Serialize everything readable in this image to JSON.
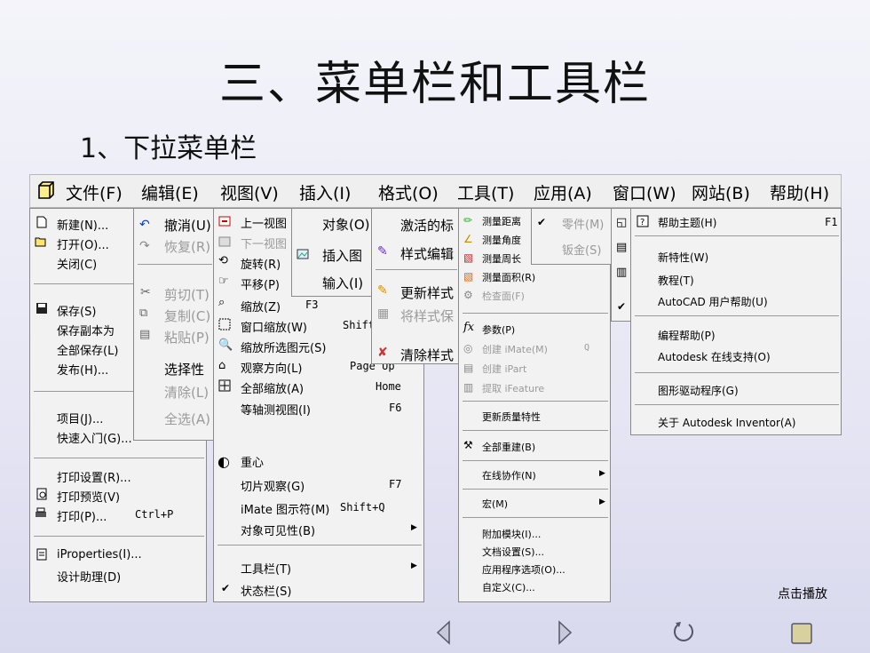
{
  "title": "三、菜单栏和工具栏",
  "subtitle": "1、下拉菜单栏",
  "menubar": [
    "文件(F)",
    "编辑(E)",
    "视图(V)",
    "插入(I)",
    "格式(O)",
    "工具(T)",
    "应用(A)",
    "窗口(W)",
    "网站(B)",
    "帮助(H)"
  ],
  "file_menu": {
    "items": [
      "新建(N)...",
      "打开(O)...",
      "关闭(C)",
      "保存(S)",
      "保存副本为",
      "全部保存(L)",
      "发布(H)...",
      "项目(J)...",
      "快速入门(G)",
      "打印设置(R)...",
      "打印预览(V)",
      "打印(P)...",
      "iProperties(I)...",
      "设计助理(D)"
    ],
    "print_shortcut": "Ctrl+P",
    "quick_suffix": "..."
  },
  "edit_menu": {
    "items": [
      "撤消(U)",
      "恢复(R)",
      "剪切(T)",
      "复制(C)",
      "粘贴(P)",
      "选择性",
      "清除(L)",
      "全选(A)"
    ]
  },
  "view_menu": {
    "items": [
      "上一视图",
      "下一视图",
      "旋转(R)",
      "平移(P)",
      "缩放(Z)",
      "窗口缩放(W)",
      "缩放所选图元(S)",
      "观察方向(L)",
      "全部缩放(A)",
      "等轴测视图(I)",
      "重心",
      "切片观察(G)",
      "iMate 图示符(M)",
      "对象可见性(B)",
      "工具栏(T)",
      "状态栏(S)"
    ],
    "shortcuts": [
      "F3",
      "Shift",
      "Page Up",
      "Home",
      "F6",
      "F7",
      "Shift+Q"
    ]
  },
  "insert_menu": {
    "items": [
      "对象(O)",
      "插入图",
      "输入(I)"
    ]
  },
  "format_menu": {
    "items": [
      "激活的标",
      "样式编辑",
      "更新样式",
      "将样式保",
      "清除样式"
    ]
  },
  "tools_menu": {
    "items": [
      "测量距离",
      "测量角度",
      "测量周长",
      "测量面积(R)",
      "检查面(F)",
      "参数(P)",
      "创建 iMate(M)",
      "创建 iPart",
      "提取 iFeature",
      "更新质量特性",
      "全部重建(B)",
      "在线协作(N)",
      "宏(M)",
      "附加模块(I)...",
      "文档设置(S)...",
      "应用程序选项(O)...",
      "自定义(C)..."
    ],
    "imate_shortcut": "Q"
  },
  "apps_menu": {
    "items": [
      "零件(M)",
      "钣金(S)"
    ]
  },
  "help_menu": {
    "items": [
      "帮助主题(H)",
      "新特性(W)",
      "教程(T)",
      "AutoCAD 用户帮助(U)",
      "编程帮助(P)",
      "Autodesk 在线支持(O)",
      "图形驱动程序(G)",
      "关于 Autodesk Inventor(A)"
    ],
    "f1": "F1"
  },
  "play_label": "点击播放",
  "nav_icons": [
    "prev-triangle",
    "next-triangle",
    "return-icon",
    "stop-square"
  ]
}
